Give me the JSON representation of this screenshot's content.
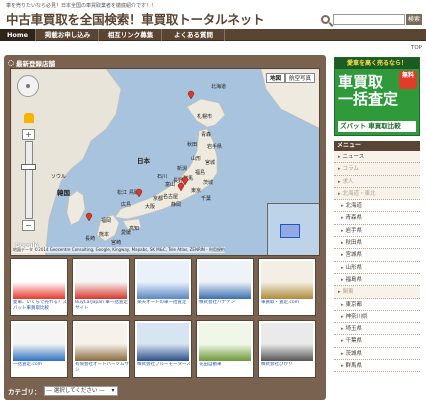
{
  "header": {
    "tagline": "車を売りたいなら必見！日本全国の車買取業者を徹底紹介です！！",
    "title": "中古車買取を全国検索！車買取トータルネット",
    "search_button": "検索",
    "search_placeholder": ""
  },
  "nav": {
    "items": [
      "Home",
      "掲載お申し込み",
      "相互リンク募集",
      "よくある質問"
    ]
  },
  "top_link": "TOP",
  "main": {
    "section_title": "最新登録店舗",
    "map": {
      "type_buttons": [
        "地図",
        "航空写真"
      ],
      "labels": [
        "日本",
        "北海道",
        "札幌市",
        "青森",
        "岩手県",
        "秋田",
        "山形",
        "宮城",
        "福島",
        "新潟",
        "東京",
        "大阪",
        "京都",
        "広島",
        "福岡",
        "松江",
        "鳥取",
        "長崎",
        "熊本",
        "宮崎",
        "高知",
        "愛媛",
        "名古屋",
        "静岡",
        "長野",
        "石川",
        "富山",
        "群馬",
        "茨城",
        "千葉",
        "韓国",
        "ソウル"
      ],
      "copyright": "地図データ ©2014 Geocentre Consulting, Google, Kingway, Mapabc, SK M&C, Tele Atlas, ZENRIN - 利用規約",
      "google": "Google"
    },
    "thumbnails": [
      {
        "caption": "愛車、いくらで売れる？ズバット車買取比較",
        "colors": [
          "#ffffff",
          "#e8392b"
        ]
      },
      {
        "caption": "BuyCarJapan 車一括査定サイト",
        "colors": [
          "#f5f5f5",
          "#d9362b"
        ]
      },
      {
        "caption": "楽天オートの車一括査定",
        "colors": [
          "#e9f1fb",
          "#5a86c4"
        ]
      },
      {
        "caption": "株式会社ハナテン",
        "colors": [
          "#eef3f8",
          "#3a6fb0"
        ]
      },
      {
        "caption": "車買取・査定.com",
        "colors": [
          "#f3efe4",
          "#b08a3c"
        ]
      },
      {
        "caption": "一括査定.com",
        "colors": [
          "#f4f4f4",
          "#2c72c2"
        ]
      },
      {
        "caption": "有限会社オートパーツムサシ",
        "colors": [
          "#f6f2ea",
          "#8a6a3a"
        ]
      },
      {
        "caption": "株式会社ブルーモータース",
        "colors": [
          "#d7e4f2",
          "#2c4f88"
        ]
      },
      {
        "caption": "花田自動車",
        "colors": [
          "#f1f7e8",
          "#6d9a3a"
        ]
      },
      {
        "caption": "株式会社ひかり",
        "colors": [
          "#eaeaea",
          "#555555"
        ]
      }
    ],
    "category_label": "カテゴリ：",
    "category_select": "— 選択してください —"
  },
  "sidebar": {
    "banner_top": "愛車を高く売るなら！",
    "banner_main_1": "車買取",
    "banner_main_2": "一括査定",
    "banner_free": "無料",
    "banner_logo": "ズバット 車買取比較",
    "menu_title": "メニュー",
    "menu_items": [
      {
        "label": "ニュース",
        "muted": false,
        "sub": false
      },
      {
        "label": "コラム",
        "muted": true,
        "sub": false
      },
      {
        "label": "求人",
        "muted": true,
        "sub": false
      },
      {
        "label": "北海道・東北",
        "muted": true,
        "sub": false
      },
      {
        "label": "北海道",
        "muted": false,
        "sub": true
      },
      {
        "label": "青森県",
        "muted": false,
        "sub": true
      },
      {
        "label": "岩手県",
        "muted": false,
        "sub": true
      },
      {
        "label": "秋田県",
        "muted": false,
        "sub": true
      },
      {
        "label": "宮城県",
        "muted": false,
        "sub": true
      },
      {
        "label": "山形県",
        "muted": false,
        "sub": true
      },
      {
        "label": "福島県",
        "muted": false,
        "sub": true
      },
      {
        "label": "関東",
        "muted": true,
        "sub": false
      },
      {
        "label": "東京都",
        "muted": false,
        "sub": true
      },
      {
        "label": "神奈川県",
        "muted": false,
        "sub": true
      },
      {
        "label": "埼玉県",
        "muted": false,
        "sub": true
      },
      {
        "label": "千葉県",
        "muted": false,
        "sub": true
      },
      {
        "label": "茨城県",
        "muted": false,
        "sub": true
      },
      {
        "label": "群馬県",
        "muted": false,
        "sub": true
      }
    ]
  },
  "colors": {
    "brand_brown": "#5a4535",
    "panel_brown": "#7a6250",
    "banner_green": "#2e9a3a",
    "link_blue": "#2255aa"
  }
}
